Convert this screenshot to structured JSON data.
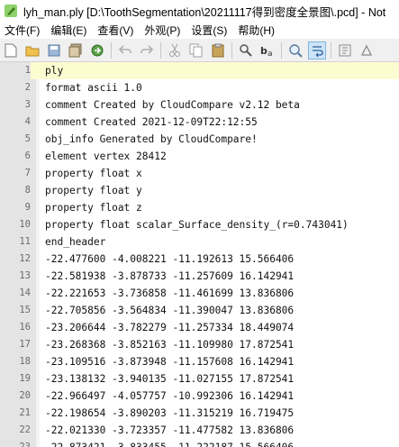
{
  "window": {
    "title": "lyh_man.ply [D:\\ToothSegmentation\\20211117得到密度全景图\\.pcd] - Not"
  },
  "menu": [
    "文件(F)",
    "编辑(E)",
    "查看(V)",
    "外观(P)",
    "设置(S)",
    "帮助(H)"
  ],
  "toolbar": {
    "icons": [
      "new-file-icon",
      "open-folder-icon",
      "save-icon",
      "save-all-icon",
      "reload-icon",
      "undo-icon",
      "redo-icon",
      "cut-icon",
      "copy-icon",
      "paste-icon",
      "find-icon",
      "replace-icon",
      "zoom-icon",
      "word-wrap-icon",
      "settings-icon",
      "help-icon"
    ]
  },
  "editor": {
    "current_line": 1,
    "lines": [
      {
        "num": "1",
        "text": "ply"
      },
      {
        "num": "2",
        "text": "format ascii 1.0"
      },
      {
        "num": "3",
        "text": "comment Created by CloudCompare v2.12 beta"
      },
      {
        "num": "4",
        "text": "comment Created 2021-12-09T22:12:55"
      },
      {
        "num": "5",
        "text": "obj_info Generated by CloudCompare!"
      },
      {
        "num": "6",
        "text": "element vertex 28412"
      },
      {
        "num": "7",
        "text": "property float x"
      },
      {
        "num": "8",
        "text": "property float y"
      },
      {
        "num": "9",
        "text": "property float z"
      },
      {
        "num": "10",
        "text": "property float scalar_Surface_density_(r=0.743041)"
      },
      {
        "num": "11",
        "text": "end_header"
      },
      {
        "num": "12",
        "text": "-22.477600 -4.008221 -11.192613 15.566406"
      },
      {
        "num": "13",
        "text": "-22.581938 -3.878733 -11.257609 16.142941"
      },
      {
        "num": "14",
        "text": "-22.221653 -3.736858 -11.461699 13.836806"
      },
      {
        "num": "15",
        "text": "-22.705856 -3.564834 -11.390047 13.836806"
      },
      {
        "num": "16",
        "text": "-23.206644 -3.782279 -11.257334 18.449074"
      },
      {
        "num": "17",
        "text": "-23.268368 -3.852163 -11.109980 17.872541"
      },
      {
        "num": "18",
        "text": "-23.109516 -3.873948 -11.157608 16.142941"
      },
      {
        "num": "19",
        "text": "-23.138132 -3.940135 -11.027155 17.872541"
      },
      {
        "num": "20",
        "text": "-22.966497 -4.057757 -10.992306 16.142941"
      },
      {
        "num": "21",
        "text": "-22.198654 -3.890203 -11.315219 16.719475"
      },
      {
        "num": "22",
        "text": "-22.021330 -3.723357 -11.477582 13.836806"
      },
      {
        "num": "23",
        "text": "-22.873421 -3.833455 -11.222187 15.566406"
      }
    ]
  }
}
